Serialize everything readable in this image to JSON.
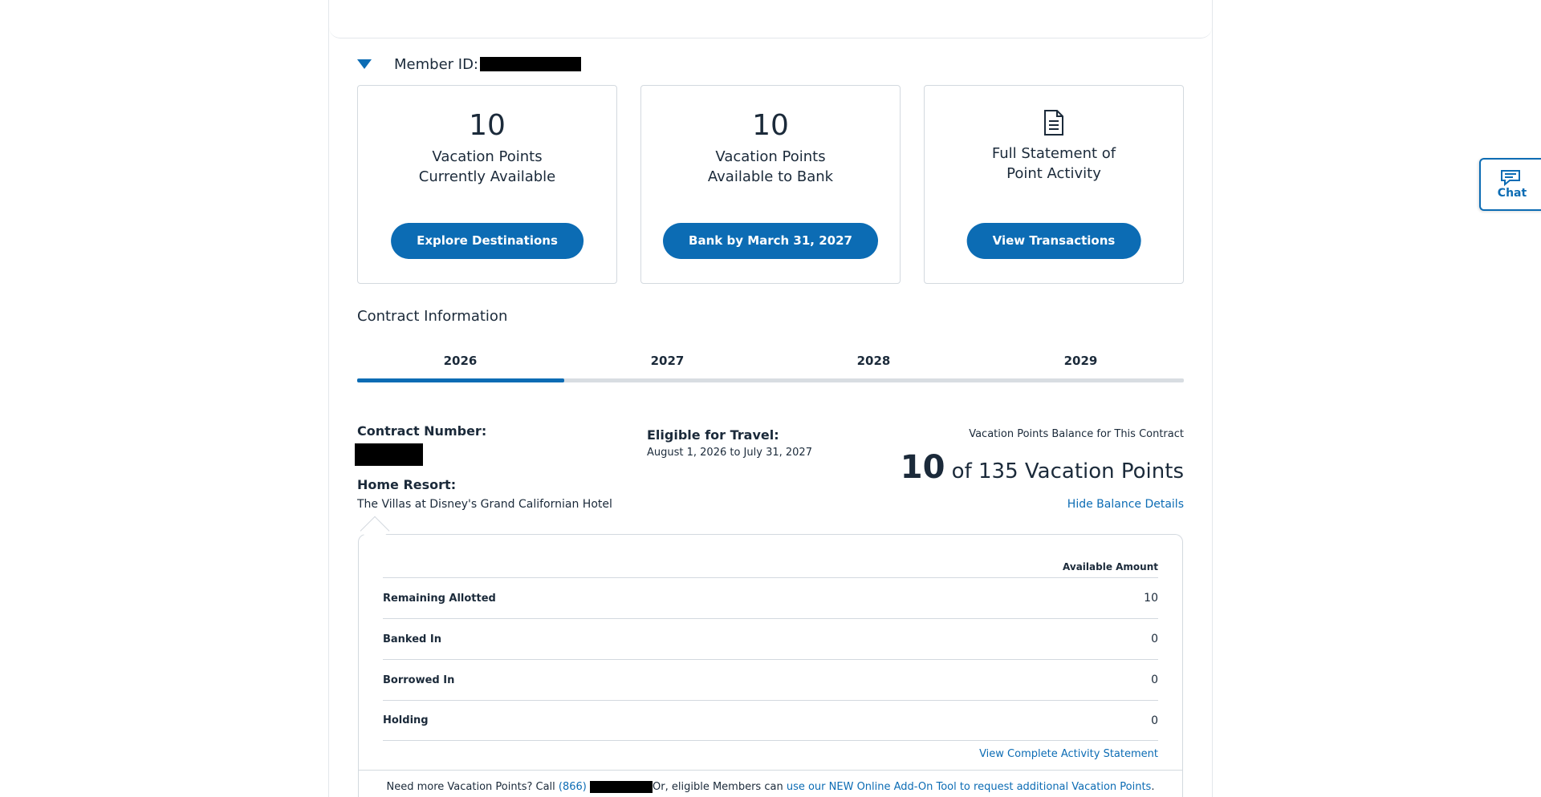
{
  "member": {
    "label": "Member ID:"
  },
  "cards": [
    {
      "number": "10",
      "line1": "Vacation Points",
      "line2": "Currently Available",
      "button": "Explore Destinations"
    },
    {
      "number": "10",
      "line1": "Vacation Points",
      "line2": "Available to Bank",
      "button": "Bank by March 31, 2027"
    },
    {
      "icon": "document-icon",
      "line1": "Full Statement of",
      "line2": "Point Activity",
      "button": "View Transactions"
    }
  ],
  "contract": {
    "title": "Contract Information",
    "tabs": [
      "2026",
      "2027",
      "2028",
      "2029"
    ],
    "active_tab": "2026",
    "number_label": "Contract Number:",
    "home_resort_label": "Home Resort:",
    "home_resort": "The Villas at Disney's Grand Californian Hotel",
    "eligible_label": "Eligible for Travel:",
    "eligible_dates": "August 1, 2026 to July 31, 2027",
    "balance_label": "Vacation Points Balance for This Contract",
    "balance_current": "10",
    "balance_rest": "of 135 Vacation Points",
    "hide_details": "Hide Balance Details"
  },
  "details": {
    "column_header": "Available Amount",
    "rows": [
      {
        "name": "Remaining Allotted",
        "value": "10"
      },
      {
        "name": "Banked In",
        "value": "0"
      },
      {
        "name": "Borrowed In",
        "value": "0"
      },
      {
        "name": "Holding",
        "value": "0"
      }
    ],
    "view_complete": "View Complete Activity Statement",
    "need_more_prefix": "Need more Vacation Points? Call",
    "phone_prefix": "(866)",
    "need_more_mid": "Or, eligible Members can",
    "addon_link": "use our NEW Online Add-On Tool to request additional Vacation Points",
    "need_more_suffix": "."
  },
  "chat": {
    "label": "Chat"
  },
  "colors": {
    "accent": "#0c6cb4",
    "text": "#1b2a3a",
    "border": "#d3d9df"
  }
}
